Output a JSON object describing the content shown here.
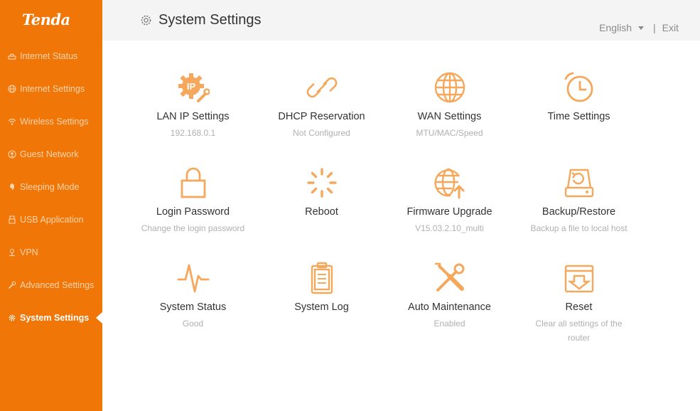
{
  "brand": {
    "logo_text": "Tenda",
    "accent": "#f07607",
    "icon_color": "#f5a85c"
  },
  "sidebar": {
    "items": [
      {
        "label": "Internet Status",
        "icon": "router-icon"
      },
      {
        "label": "Internet Settings",
        "icon": "globe-icon"
      },
      {
        "label": "Wireless Settings",
        "icon": "wifi-icon"
      },
      {
        "label": "Guest Network",
        "icon": "guest-network-icon"
      },
      {
        "label": "Sleeping Mode",
        "icon": "sleep-icon"
      },
      {
        "label": "USB Application",
        "icon": "usb-icon"
      },
      {
        "label": "VPN",
        "icon": "vpn-icon"
      },
      {
        "label": "Advanced Settings",
        "icon": "wrench-icon"
      },
      {
        "label": "System Settings",
        "icon": "gear-icon",
        "active": true
      }
    ]
  },
  "header": {
    "title": "System Settings",
    "language": "English",
    "separator": "|",
    "exit_label": "Exit"
  },
  "tiles": [
    {
      "label": "LAN IP Settings",
      "sub": "192.168.0.1",
      "icon": "lan-ip-gear-icon"
    },
    {
      "label": "DHCP Reservation",
      "sub": "Not Configured",
      "icon": "link-icon"
    },
    {
      "label": "WAN Settings",
      "sub": "MTU/MAC/Speed",
      "icon": "globe-icon"
    },
    {
      "label": "Time Settings",
      "sub": "",
      "icon": "alarm-clock-icon"
    },
    {
      "label": "Login Password",
      "sub": "Change the login password",
      "icon": "lock-icon"
    },
    {
      "label": "Reboot",
      "sub": "",
      "icon": "reboot-spinner-icon"
    },
    {
      "label": "Firmware Upgrade",
      "sub": "V15.03.2.10_multi",
      "icon": "globe-upload-icon"
    },
    {
      "label": "Backup/Restore",
      "sub": "Backup a file to local host",
      "icon": "backup-disk-icon"
    },
    {
      "label": "System Status",
      "sub": "Good",
      "icon": "pulse-icon"
    },
    {
      "label": "System Log",
      "sub": "",
      "icon": "clipboard-log-icon"
    },
    {
      "label": "Auto Maintenance",
      "sub": "Enabled",
      "icon": "tools-icon"
    },
    {
      "label": "Reset",
      "sub": "Clear all settings of the router",
      "icon": "reset-box-icon"
    }
  ]
}
